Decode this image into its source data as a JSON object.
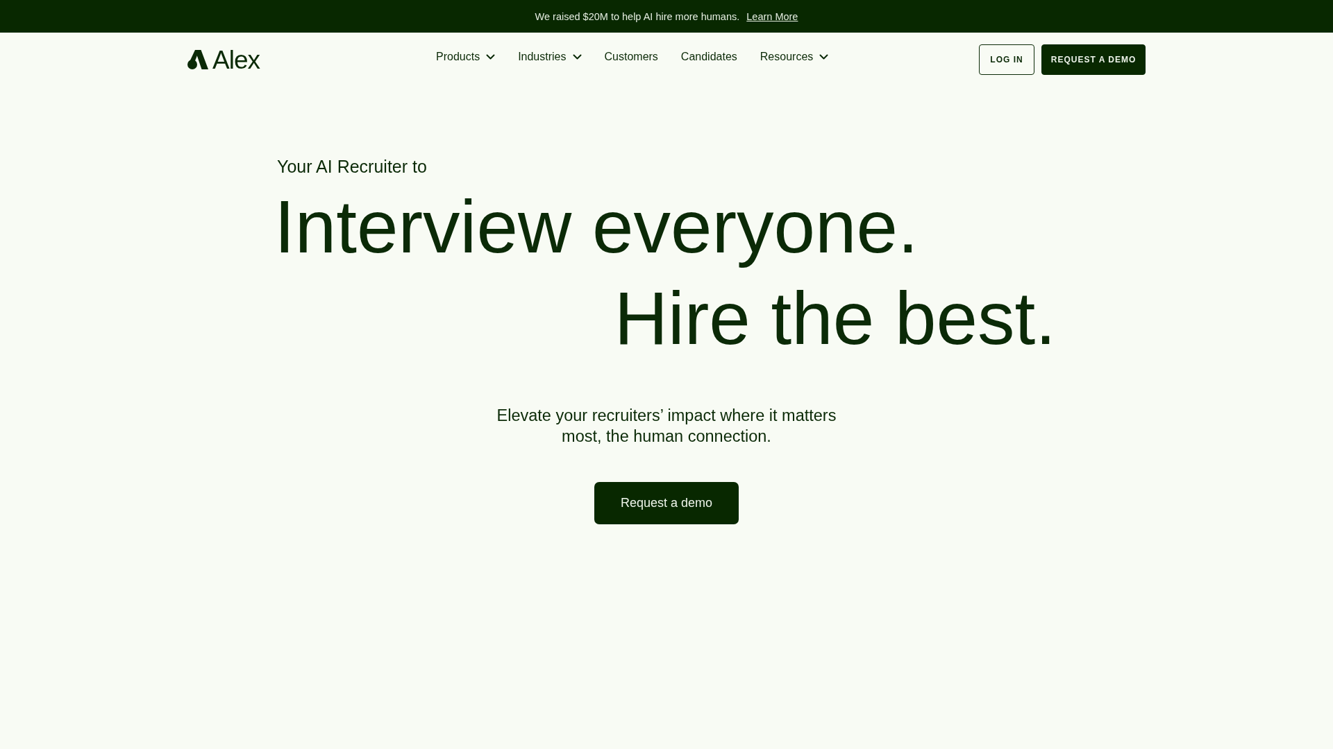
{
  "announcement": {
    "text": "We raised $20M to help AI hire more humans.",
    "link": "Learn More"
  },
  "header": {
    "logo": "Alex",
    "nav": [
      {
        "label": "Products",
        "dropdown": true
      },
      {
        "label": "Industries",
        "dropdown": true
      },
      {
        "label": "Customers",
        "dropdown": false
      },
      {
        "label": "Candidates",
        "dropdown": false
      },
      {
        "label": "Resources",
        "dropdown": true
      }
    ],
    "buttons": [
      {
        "label": "LOG IN",
        "kind": "outline"
      },
      {
        "label": "REQUEST A DEMO",
        "kind": "filled"
      }
    ]
  },
  "hero": {
    "eyebrow": "Your AI Recruiter to",
    "headline": [
      "Interview everyone.",
      "Hire the best."
    ],
    "subtitle": "Elevate your recruiters’ impact where it matters most, the human connection.",
    "cta": "Request a demo"
  }
}
